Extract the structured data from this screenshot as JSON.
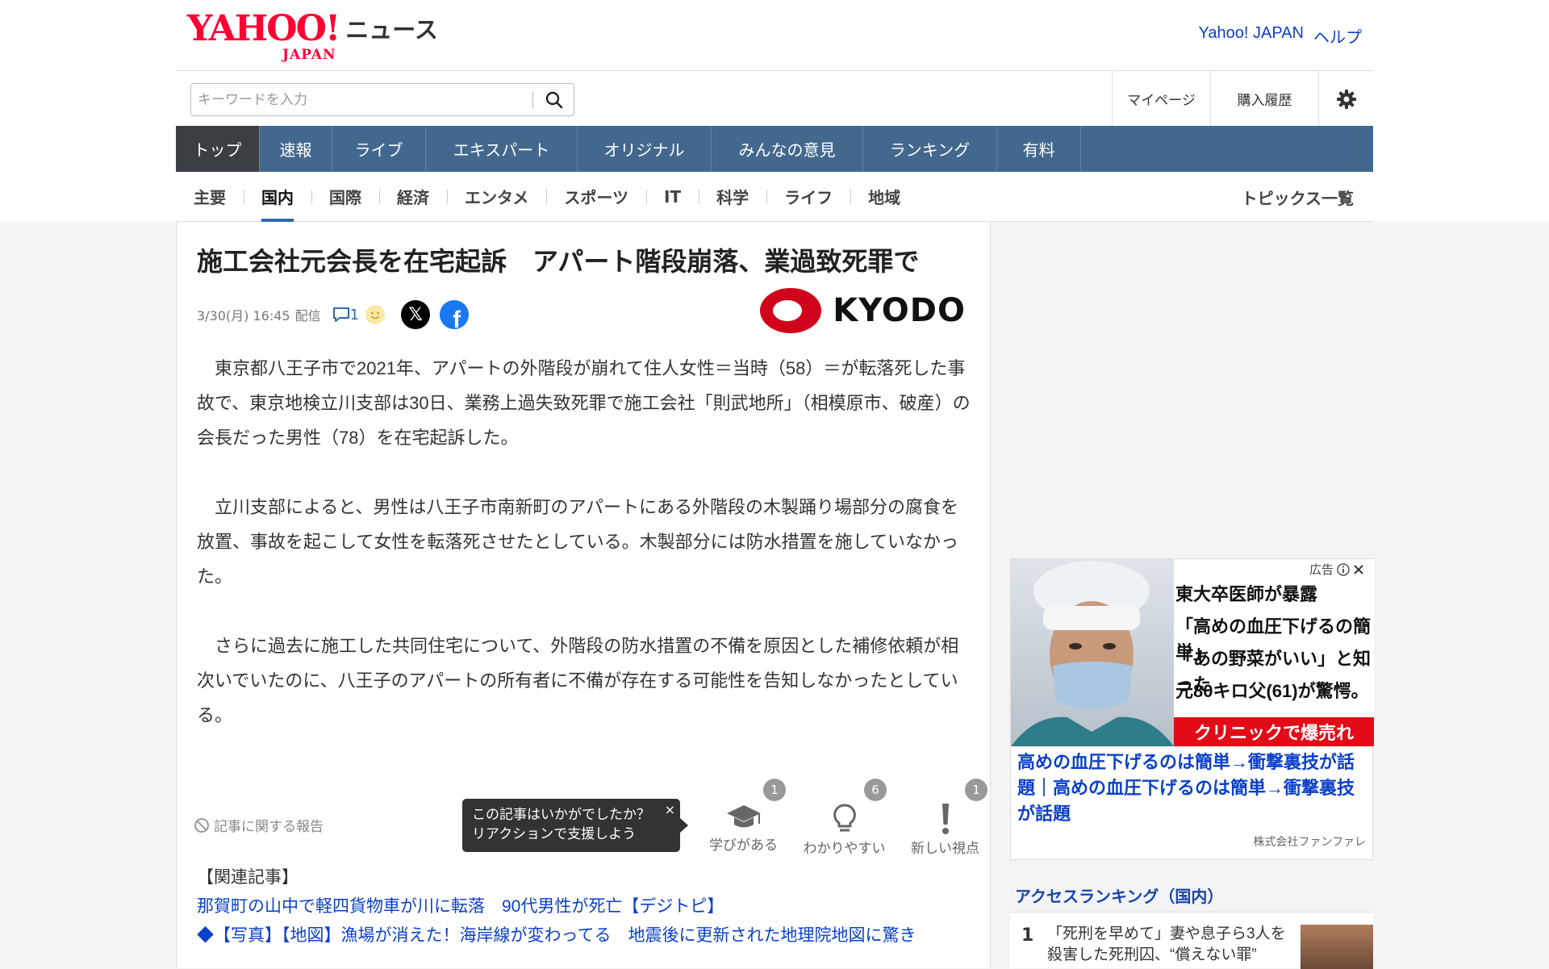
{
  "header": {
    "logo_yahoo": "YAHOO!",
    "logo_japan": "JAPAN",
    "logo_news": "ニュース",
    "links": [
      "Yahoo! JAPAN",
      "ヘルプ"
    ]
  },
  "search": {
    "placeholder": "キーワードを入力",
    "icon": "search-icon"
  },
  "user_links": {
    "mypage": "マイページ",
    "history": "購入履歴",
    "settings_icon": "gear-icon"
  },
  "main_nav": {
    "items": [
      "トップ",
      "速報",
      "ライブ",
      "エキスパート",
      "オリジナル",
      "みんなの意見",
      "ランキング",
      "有料"
    ],
    "active_index": 0
  },
  "sub_nav": {
    "items": [
      "主要",
      "国内",
      "国際",
      "経済",
      "エンタメ",
      "スポーツ",
      "IT",
      "科学",
      "ライフ",
      "地域"
    ],
    "active_index": 1,
    "topics_link": "トピックス一覧"
  },
  "article": {
    "headline": "施工会社元会長を在宅起訴　アパート階段崩落、業過致死罪で",
    "date": "3/30(月) 16:45",
    "date_suffix": "配信",
    "comment_count": "1",
    "source_name": "KYODO",
    "paragraphs": [
      "東京都八王子市で2021年、アパートの外階段が崩れて住人女性＝当時（58）＝が転落死した事故で、東京地検立川支部は30日、業務上過失致死罪で施工会社「則武地所」（相模原市、破産）の会長だった男性（78）を在宅起訴した。",
      "立川支部によると、男性は八王子市南新町のアパートにある外階段の木製踊り場部分の腐食を放置、事故を起こして女性を転落死させたとしている。木製部分には防水措置を施していなかった。",
      "さらに過去に施工した共同住宅について、外階段の防水措置の不備を原因とした補修依頼が相次いでいたのに、八王子のアパートの所有者に不備が存在する可能性を告知しなかったとしている。"
    ],
    "report_link": "記事に関する報告",
    "tooltip": {
      "line1": "この記事はいかがでしたか？",
      "line2": "リアクションで支援しよう",
      "close": "×"
    },
    "reactions": [
      {
        "label": "学びがある",
        "count": "1",
        "icon": "graduation-cap-icon"
      },
      {
        "label": "わかりやすい",
        "count": "6",
        "icon": "lightbulb-icon"
      },
      {
        "label": "新しい視点",
        "count": "1",
        "icon": "exclamation-icon"
      }
    ],
    "related_heading": "【関連記事】",
    "related_links": [
      "那賀町の山中で軽四貨物車が川に転落　90代男性が死亡【デジトピ】",
      "◆【写真】【地図】漁場が消えた！海岸線が変わってる　地震後に更新された地理院地図に驚き"
    ]
  },
  "ad": {
    "tag": "広告",
    "copy_lines": [
      "東大卒医師が暴露",
      "「高めの血圧下げるの簡単」",
      "「あの野菜がいい」と知った",
      "元80キロ父(61)が驚愕。"
    ],
    "cta": "クリニックで爆売れ",
    "title": "高めの血圧下げるのは簡単→衝撃裏技が話題｜高めの血圧下げるのは簡単→衝撃裏技が話題",
    "sponsor": "株式会社ファンファレ"
  },
  "ranking": {
    "title": "アクセスランキング（国内）",
    "items": [
      {
        "rank": "1",
        "text": "「死刑を早めて」妻や息子ら3人を殺害した死刑囚、“償えない罪”"
      }
    ]
  },
  "colors": {
    "nav_bg": "#43688e",
    "nav_active": "#3b3f44",
    "link": "#0b40c9",
    "brand_red": "#ff0033",
    "cta_red": "#e30b17"
  }
}
